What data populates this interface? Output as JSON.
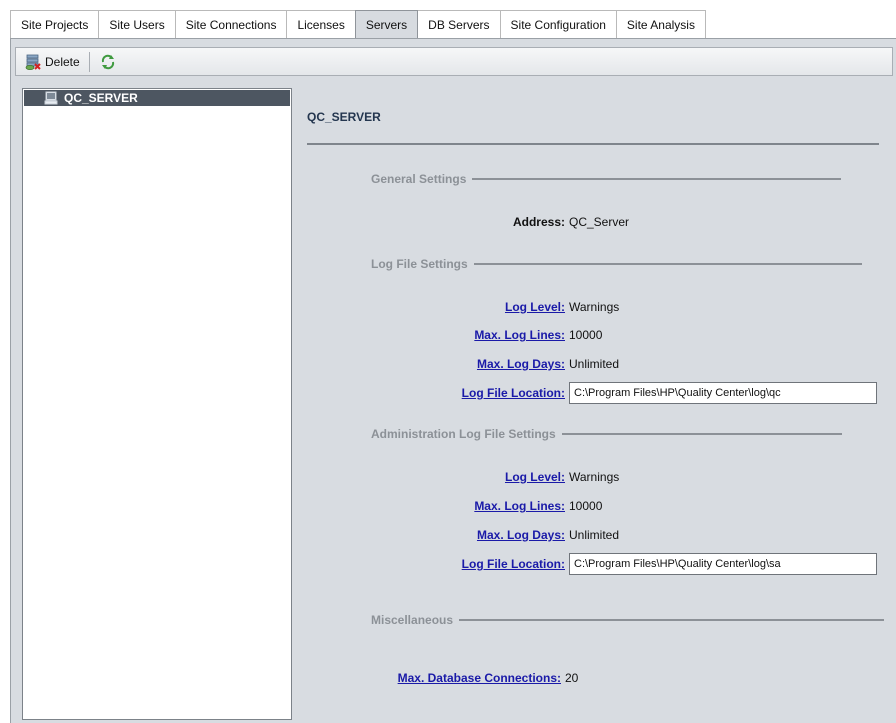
{
  "tabs": [
    {
      "label": "Site Projects",
      "active": false
    },
    {
      "label": "Site Users",
      "active": false
    },
    {
      "label": "Site Connections",
      "active": false
    },
    {
      "label": "Licenses",
      "active": false
    },
    {
      "label": "Servers",
      "active": true
    },
    {
      "label": "DB Servers",
      "active": false
    },
    {
      "label": "Site Configuration",
      "active": false
    },
    {
      "label": "Site Analysis",
      "active": false
    }
  ],
  "toolbar": {
    "delete_label": "Delete",
    "delete_icon": "delete-server-icon",
    "refresh_icon": "refresh-icon"
  },
  "tree": {
    "items": [
      {
        "label": "QC_SERVER",
        "icon": "server-icon",
        "selected": true
      }
    ]
  },
  "details": {
    "title": "QC_SERVER",
    "general": {
      "heading": "General Settings",
      "address_label": "Address:",
      "address_value": "QC_Server"
    },
    "log": {
      "heading": "Log File Settings",
      "level_label": "Log Level:",
      "level_value": "Warnings",
      "lines_label": "Max. Log Lines:",
      "lines_value": "10000",
      "days_label": "Max. Log Days:",
      "days_value": "Unlimited",
      "location_label": "Log File Location:",
      "location_value": "C:\\Program Files\\HP\\Quality Center\\log\\qc"
    },
    "admin_log": {
      "heading": "Administration Log File Settings",
      "level_label": "Log Level:",
      "level_value": "Warnings",
      "lines_label": "Max. Log Lines:",
      "lines_value": "10000",
      "days_label": "Max. Log Days:",
      "days_value": "Unlimited",
      "location_label": "Log File Location:",
      "location_value": "C:\\Program Files\\HP\\Quality Center\\log\\sa"
    },
    "misc": {
      "heading": "Miscellaneous",
      "db_conn_label": "Max. Database Connections:",
      "db_conn_value": "20"
    }
  },
  "colors": {
    "panel_bg": "#d8dce1",
    "selected_row": "#4d5661",
    "link": "#1a1aa8",
    "section_heading": "#8c9197"
  }
}
